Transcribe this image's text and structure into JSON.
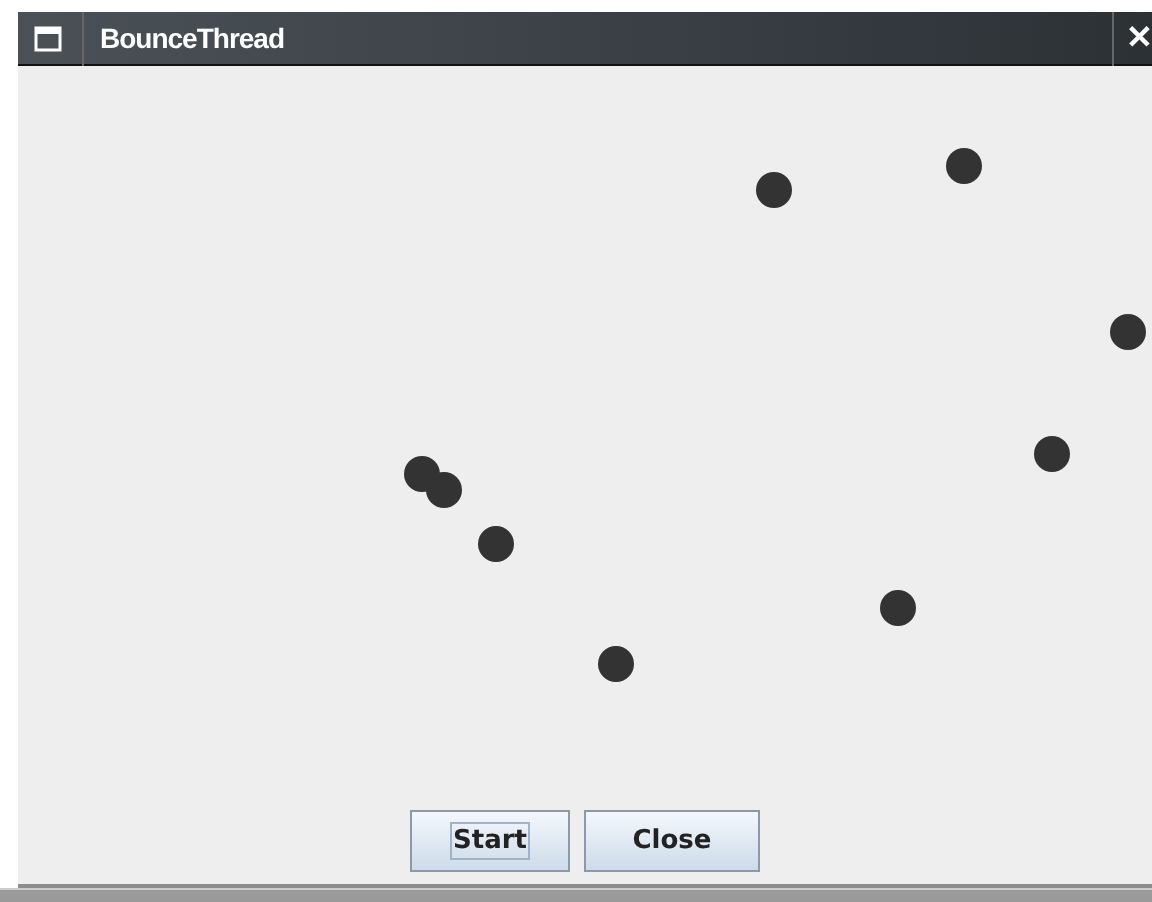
{
  "window": {
    "title": "BounceThread",
    "close_glyph": "✕"
  },
  "buttons": [
    {
      "label": "Start",
      "focused": true
    },
    {
      "label": "Close",
      "focused": false
    }
  ]
}
